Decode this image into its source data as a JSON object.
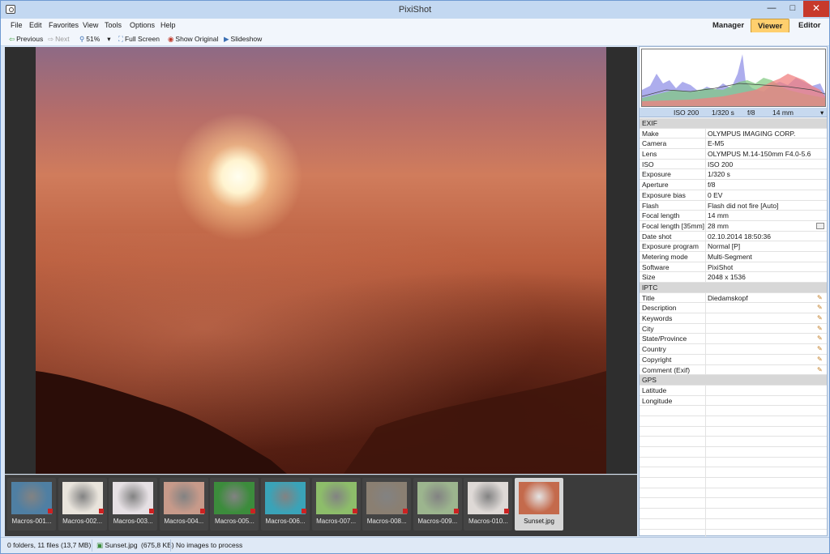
{
  "window": {
    "title": "PixiShot",
    "min": "—",
    "max": "□",
    "close": "✕"
  },
  "menu": [
    "File",
    "Edit",
    "Favorites",
    "View",
    "Tools",
    "Options",
    "Help"
  ],
  "modes": {
    "manager": "Manager",
    "viewer": "Viewer",
    "editor": "Editor",
    "active": "Viewer"
  },
  "toolbar": {
    "previous": "Previous",
    "next": "Next",
    "zoom": "51%",
    "fullscreen": "Full Screen",
    "show_original": "Show Original",
    "slideshow": "Slideshow"
  },
  "exif_bar": {
    "iso": "ISO 200",
    "shutter": "1/320 s",
    "aperture": "f/8",
    "focal": "14 mm"
  },
  "properties": [
    {
      "section": "EXIF"
    },
    {
      "key": "Make",
      "value": "OLYMPUS IMAGING CORP."
    },
    {
      "key": "Camera",
      "value": "E-M5"
    },
    {
      "key": "Lens",
      "value": "OLYMPUS M.14-150mm F4.0-5.6"
    },
    {
      "key": "ISO",
      "value": "ISO 200"
    },
    {
      "key": "Exposure",
      "value": "1/320 s"
    },
    {
      "key": "Aperture",
      "value": "f/8"
    },
    {
      "key": "Exposure bias",
      "value": "0 EV"
    },
    {
      "key": "Flash",
      "value": "Flash did not fire [Auto]"
    },
    {
      "key": "Focal length",
      "value": "14 mm"
    },
    {
      "key": "Focal length [35mm]",
      "value": "28 mm",
      "calc": true
    },
    {
      "key": "Date shot",
      "value": "02.10.2014 18:50:36"
    },
    {
      "key": "Exposure program",
      "value": "Normal [P]"
    },
    {
      "key": "Metering mode",
      "value": "Multi-Segment"
    },
    {
      "key": "Software",
      "value": "PixiShot"
    },
    {
      "key": "Size",
      "value": "2048 x 1536"
    },
    {
      "section": "IPTC"
    },
    {
      "key": "Title",
      "value": "Diedamskopf",
      "edit": true
    },
    {
      "key": "Description",
      "value": "",
      "edit": true
    },
    {
      "key": "Keywords",
      "value": "",
      "edit": true
    },
    {
      "key": "City",
      "value": "",
      "edit": true
    },
    {
      "key": "State/Province",
      "value": "",
      "edit": true
    },
    {
      "key": "Country",
      "value": "",
      "edit": true
    },
    {
      "key": "Copyright",
      "value": "",
      "edit": true
    },
    {
      "key": "Comment (Exif)",
      "value": "",
      "edit": true
    },
    {
      "section": "GPS"
    },
    {
      "key": "Latitude",
      "value": ""
    },
    {
      "key": "Longitude",
      "value": ""
    },
    {
      "key": "",
      "value": ""
    },
    {
      "key": "",
      "value": ""
    },
    {
      "key": "",
      "value": ""
    },
    {
      "key": "",
      "value": ""
    },
    {
      "key": "",
      "value": ""
    },
    {
      "key": "",
      "value": ""
    },
    {
      "key": "",
      "value": ""
    },
    {
      "key": "",
      "value": ""
    },
    {
      "key": "",
      "value": ""
    },
    {
      "key": "",
      "value": ""
    },
    {
      "key": "",
      "value": ""
    },
    {
      "key": "",
      "value": ""
    },
    {
      "key": "",
      "value": ""
    }
  ],
  "thumbnails": [
    {
      "label": "Macros-001...",
      "color": "#4f7fa3"
    },
    {
      "label": "Macros-002...",
      "color": "#e9e4dc"
    },
    {
      "label": "Macros-003...",
      "color": "#e6e0e4"
    },
    {
      "label": "Macros-004...",
      "color": "#c79a8a"
    },
    {
      "label": "Macros-005...",
      "color": "#3c8c3c"
    },
    {
      "label": "Macros-006...",
      "color": "#3aa3b8"
    },
    {
      "label": "Macros-007...",
      "color": "#8dbd6a"
    },
    {
      "label": "Macros-008...",
      "color": "#8a7f72"
    },
    {
      "label": "Macros-009...",
      "color": "#9cb58e"
    },
    {
      "label": "Macros-010...",
      "color": "#ded9d6"
    },
    {
      "label": "Sunset.jpg",
      "color": "#c46a4c",
      "selected": true
    }
  ],
  "status": {
    "counts": "0 folders,  11 files  (13,7 MB)",
    "file": "Sunset.jpg",
    "filesize": "(675,8 KB)",
    "process": "No images to process"
  },
  "colors": {
    "accent": "#ffcf6e",
    "titlebar": "#c3d8f1",
    "close": "#c7392b"
  }
}
